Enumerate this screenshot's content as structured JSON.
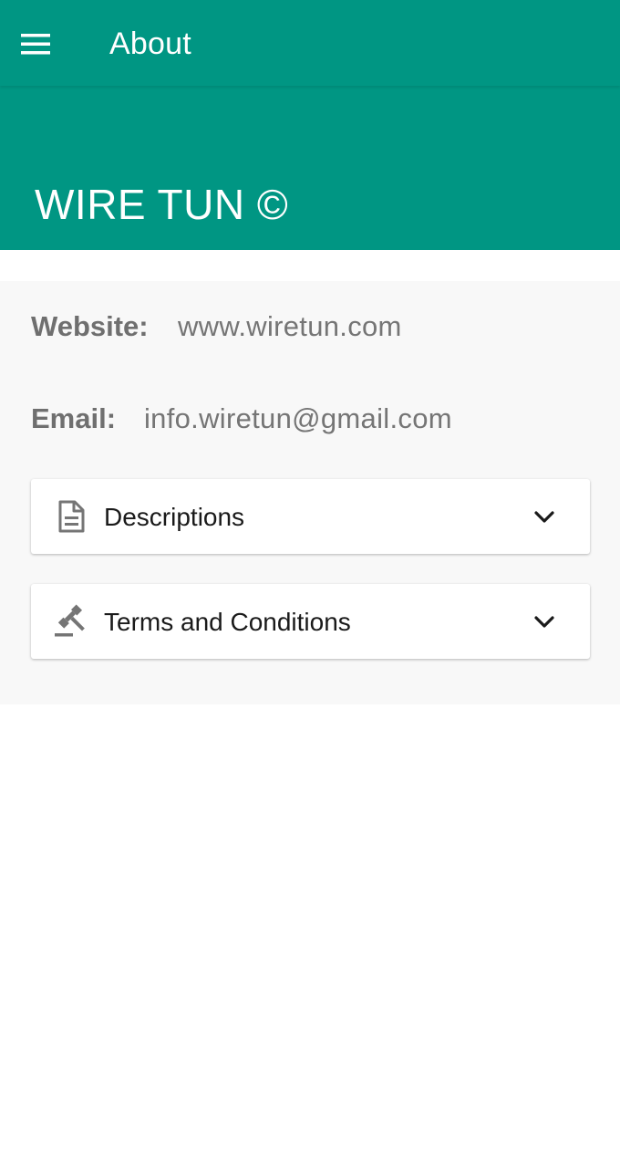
{
  "appbar": {
    "title": "About",
    "menu_icon": "menu-icon"
  },
  "hero": {
    "title": "WIRE TUN ©"
  },
  "info": {
    "website_label": "Website:",
    "website_value": "www.wiretun.com",
    "email_label": "Email:",
    "email_value": "info.wiretun@gmail.com"
  },
  "sections": [
    {
      "label": "Descriptions",
      "icon": "document-icon",
      "state_icon": "chevron-down-icon"
    },
    {
      "label": "Terms and Conditions",
      "icon": "gavel-icon",
      "state_icon": "chevron-down-icon"
    }
  ],
  "colors": {
    "primary": "#009683",
    "panel_background": "#f8f8f8",
    "label_text": "#6f6f6f",
    "value_text": "#757575",
    "card_text": "#1a1a1a",
    "icon_gray": "#757575"
  }
}
